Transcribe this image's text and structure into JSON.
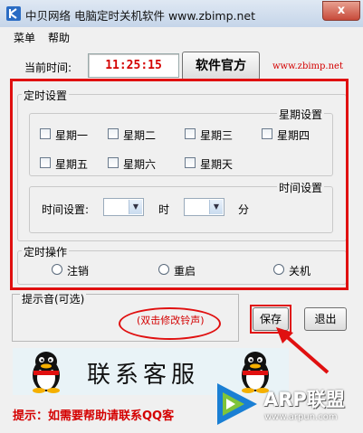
{
  "window": {
    "title": "中贝网络 电脑定时关机软件 www.zbimp.net",
    "close_label": "x"
  },
  "menu": {
    "items": [
      "菜单",
      "帮助"
    ]
  },
  "current_time": {
    "label": "当前时间:",
    "value": "11:25:15"
  },
  "official_button": "软件官方",
  "website": "www.zbimp.net",
  "timer_settings": {
    "title": "定时设置",
    "week_group": {
      "title": "星期设置",
      "days": [
        "星期一",
        "星期二",
        "星期三",
        "星期四",
        "星期五",
        "星期六",
        "星期天"
      ]
    },
    "time_group": {
      "title": "时间设置",
      "label": "时间设置:",
      "hour_unit": "时",
      "minute_unit": "分",
      "hour_value": "",
      "minute_value": ""
    }
  },
  "timer_action": {
    "title": "定时操作",
    "options": [
      "注销",
      "重启",
      "关机"
    ]
  },
  "tone": {
    "label": "提示音(可选)",
    "hint": "(双击修改铃声)"
  },
  "buttons": {
    "save": "保存",
    "exit": "退出"
  },
  "banner": {
    "text": "联系客服"
  },
  "footer": {
    "text": "提示：如需要帮助请联系QQ客"
  },
  "watermark": {
    "brand": "ARP联盟",
    "url": "www.arpun.com"
  },
  "colors": {
    "accent_red": "#e01010",
    "time_red": "#d40000",
    "arp_blue": "#1a7fd4"
  }
}
